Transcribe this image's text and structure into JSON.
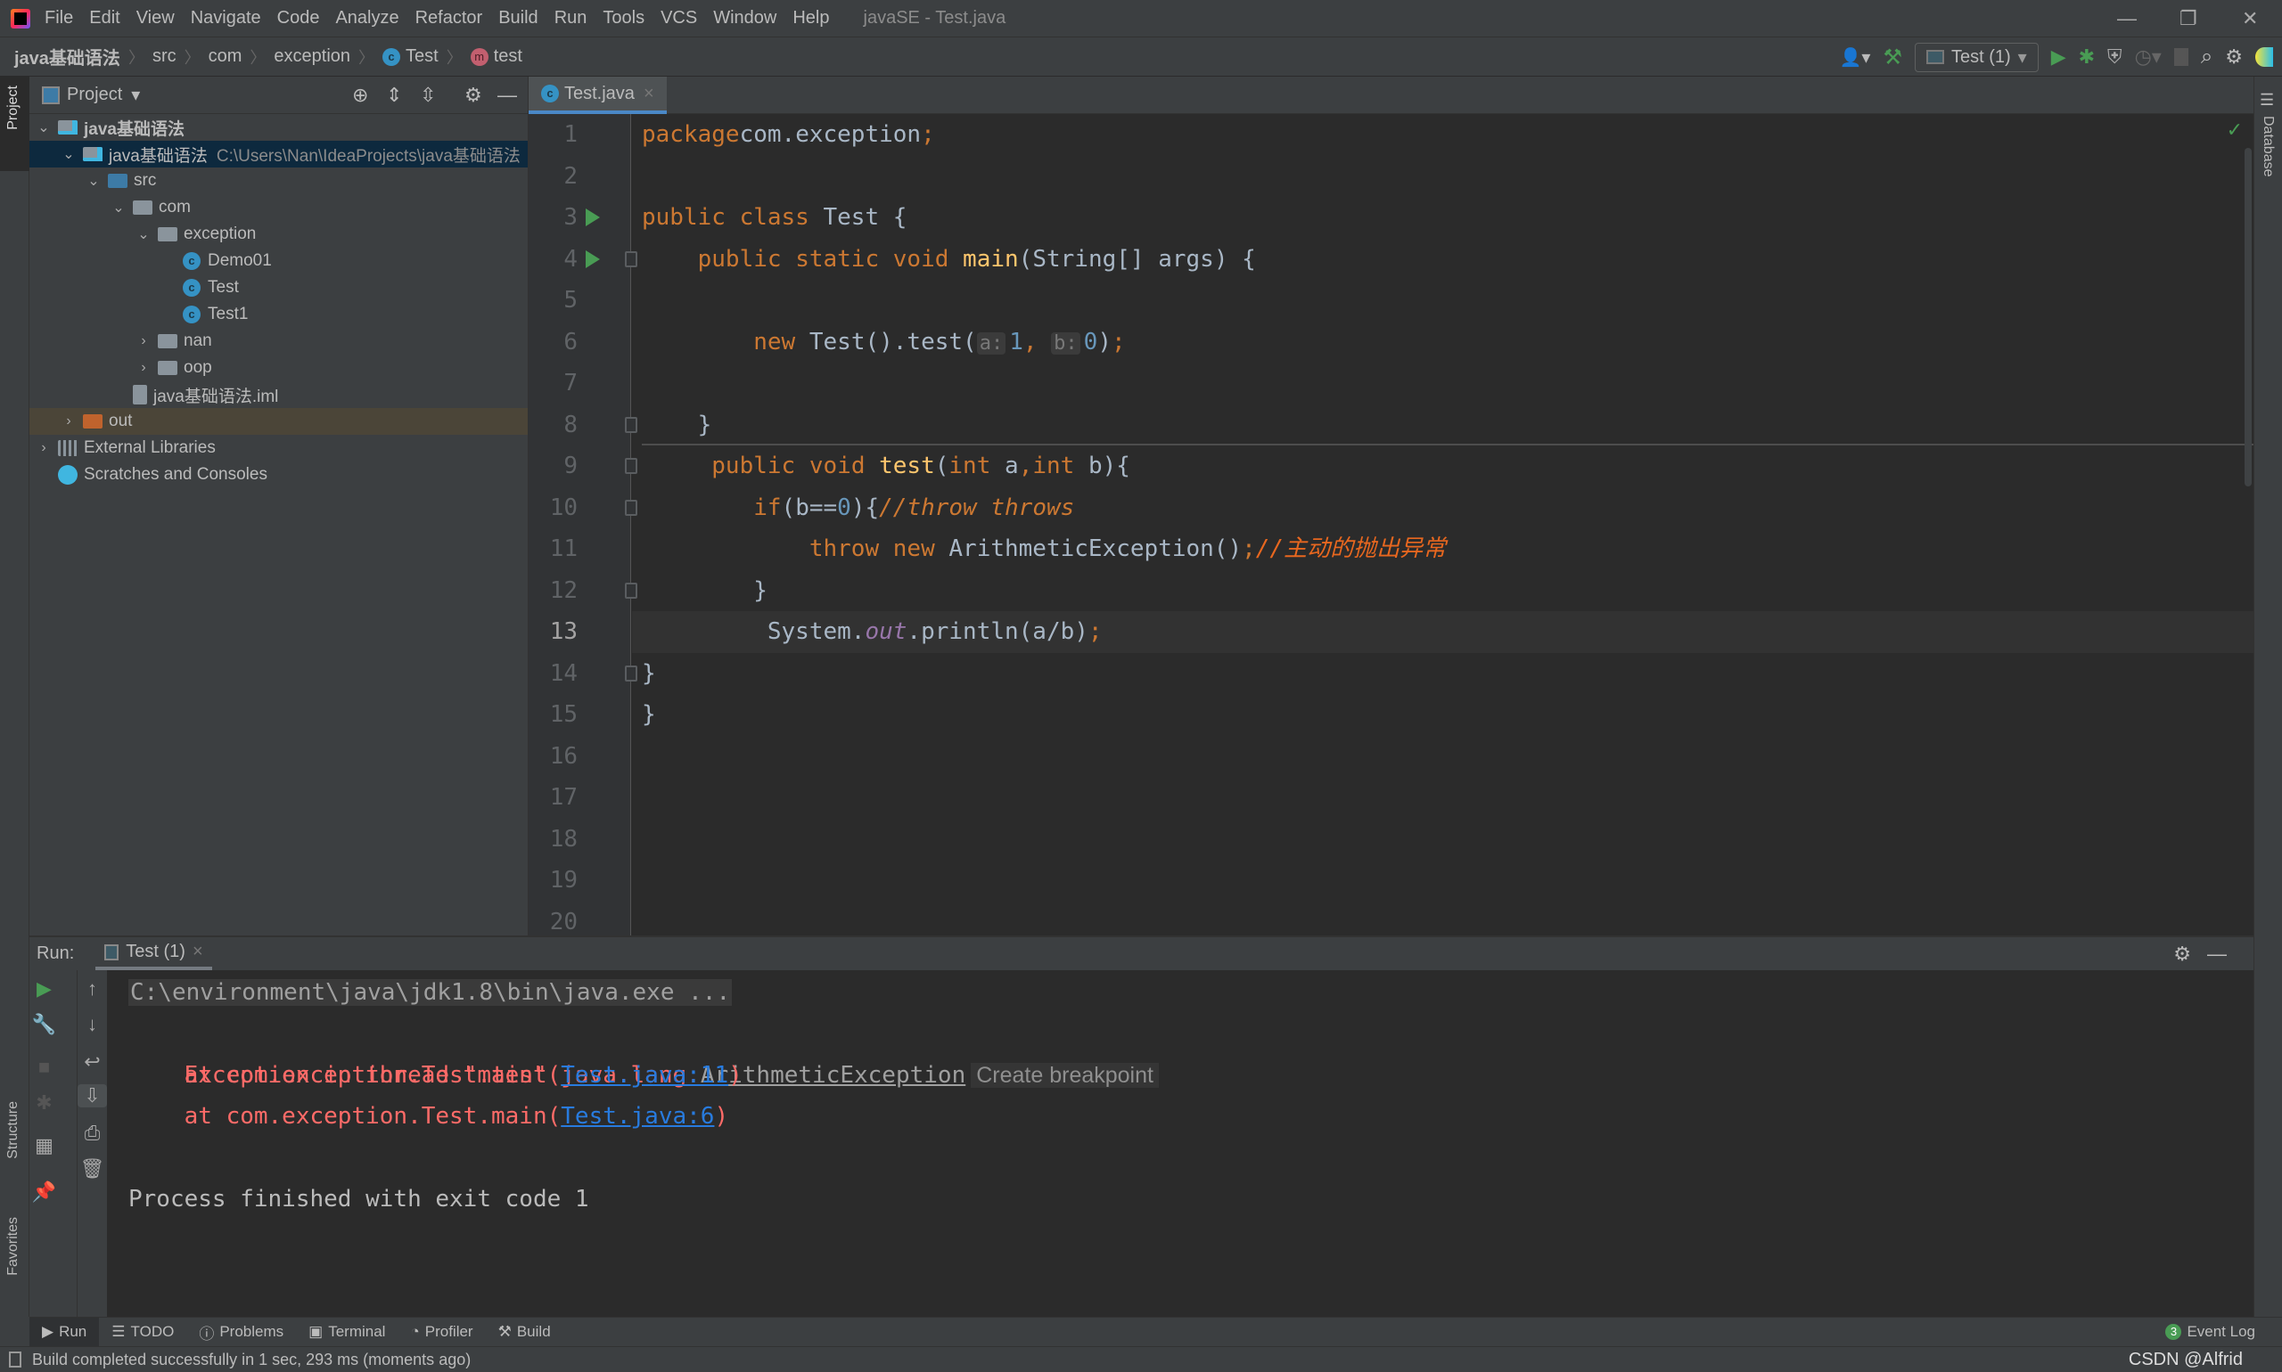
{
  "menubar": {
    "items": [
      "File",
      "Edit",
      "View",
      "Navigate",
      "Code",
      "Analyze",
      "Refactor",
      "Build",
      "Run",
      "Tools",
      "VCS",
      "Window",
      "Help"
    ],
    "window_title": "javaSE - Test.java"
  },
  "breadcrumb": [
    "java基础语法",
    "src",
    "com",
    "exception",
    "Test",
    "test"
  ],
  "toolbar": {
    "run_config": "Test (1)"
  },
  "left_strip": {
    "project": "Project",
    "structure": "Structure",
    "favorites": "Favorites"
  },
  "right_strip": {
    "database": "Database"
  },
  "project": {
    "title": "Project",
    "tree": [
      {
        "label": "java基础语法",
        "depth": 0,
        "expanded": true,
        "icon": "module"
      },
      {
        "label": "java基础语法",
        "path": "C:\\Users\\Nan\\IdeaProjects\\java基础语法",
        "depth": 1,
        "expanded": true,
        "icon": "module",
        "selected": true
      },
      {
        "label": "src",
        "depth": 2,
        "expanded": true,
        "icon": "source-folder"
      },
      {
        "label": "com",
        "depth": 3,
        "expanded": true,
        "icon": "package"
      },
      {
        "label": "exception",
        "depth": 4,
        "expanded": true,
        "icon": "package"
      },
      {
        "label": "Demo01",
        "depth": 5,
        "icon": "class"
      },
      {
        "label": "Test",
        "depth": 5,
        "icon": "class"
      },
      {
        "label": "Test1",
        "depth": 5,
        "icon": "class"
      },
      {
        "label": "nan",
        "depth": 4,
        "expanded": false,
        "icon": "package"
      },
      {
        "label": "oop",
        "depth": 4,
        "expanded": false,
        "icon": "package"
      },
      {
        "label": "java基础语法.iml",
        "depth": 3,
        "icon": "iml-file"
      },
      {
        "label": "out",
        "depth": 1,
        "expanded": false,
        "icon": "excluded-folder",
        "highlight": true
      },
      {
        "label": "External Libraries",
        "depth": 0,
        "expanded": false,
        "icon": "libraries"
      },
      {
        "label": "Scratches and Consoles",
        "depth": 0,
        "icon": "scratches"
      }
    ]
  },
  "editor": {
    "tab": "Test.java",
    "current_line": 13,
    "lines": [
      [
        [
          "kw",
          "package"
        ],
        [
          "",
          "com.exception"
        ],
        [
          "kw",
          ";"
        ]
      ],
      [],
      [
        [
          "kw",
          "public class "
        ],
        [
          "",
          "Test {"
        ]
      ],
      [
        [
          "",
          "    "
        ],
        [
          "kw",
          "public static void "
        ],
        [
          "fn",
          "main"
        ],
        [
          "",
          "(String[] args) {"
        ]
      ],
      [],
      [
        [
          "",
          "        "
        ],
        [
          "kw",
          "new "
        ],
        [
          "",
          "Test().test("
        ],
        [
          "hint",
          "a:"
        ],
        [
          "num",
          "1"
        ],
        [
          "kw",
          ", "
        ],
        [
          "hint",
          "b:"
        ],
        [
          "num",
          "0"
        ],
        [
          "",
          ")"
        ],
        [
          "kw",
          ";"
        ]
      ],
      [],
      [
        [
          "",
          "    }"
        ]
      ],
      [
        [
          "",
          "     "
        ],
        [
          "kw",
          "public void "
        ],
        [
          "fn",
          "test"
        ],
        [
          "",
          "("
        ],
        [
          "kw",
          "int "
        ],
        [
          "",
          "a"
        ],
        [
          "kw",
          ","
        ],
        [
          "kw",
          "int "
        ],
        [
          "",
          "b){"
        ]
      ],
      [
        [
          "",
          "        "
        ],
        [
          "kw",
          "if"
        ],
        [
          "",
          "(b=="
        ],
        [
          "num",
          "0"
        ],
        [
          "",
          "){"
        ],
        [
          "cm",
          "//throw throws"
        ]
      ],
      [
        [
          "",
          "            "
        ],
        [
          "kw",
          "throw new "
        ],
        [
          "",
          "ArithmeticException()"
        ],
        [
          "kw",
          ";"
        ],
        [
          "cm2",
          "//主动的抛出异常"
        ]
      ],
      [
        [
          "",
          "        }"
        ]
      ],
      [
        [
          "",
          "         System."
        ],
        [
          "st",
          "out"
        ],
        [
          "",
          ".println(a/b)"
        ],
        [
          "kw",
          ";"
        ]
      ],
      [
        [
          "",
          "}"
        ]
      ],
      [
        [
          "",
          "}"
        ]
      ],
      [],
      [],
      [],
      [],
      []
    ]
  },
  "run": {
    "label": "Run:",
    "tab": "Test (1)",
    "console": {
      "command": "C:\\environment\\java\\jdk1.8\\bin\\java.exe ...",
      "exception_prefix": "Exception in thread \"main\" java.lang.",
      "exception_class": "ArithmeticException",
      "create_breakpoint": "Create breakpoint",
      "trace": [
        {
          "text": "    at com.exception.Test.test(",
          "link": "Test.java:11",
          "end": ")"
        },
        {
          "text": "    at com.exception.Test.main(",
          "link": "Test.java:6",
          "end": ")"
        }
      ],
      "exit": "Process finished with exit code 1"
    }
  },
  "bottom_tabs": [
    "Run",
    "TODO",
    "Problems",
    "Terminal",
    "Profiler",
    "Build"
  ],
  "event_log": {
    "label": "Event Log",
    "count": "3"
  },
  "status": {
    "message": "Build completed successfully in 1 sec, 293 ms (moments ago)",
    "watermark": "CSDN @Alfrid"
  },
  "colors": {
    "keyword": "#cc7832",
    "method": "#ffc66d",
    "number": "#6897bb",
    "error": "#ff6b68",
    "link": "#287bde",
    "run_green": "#499c54"
  }
}
